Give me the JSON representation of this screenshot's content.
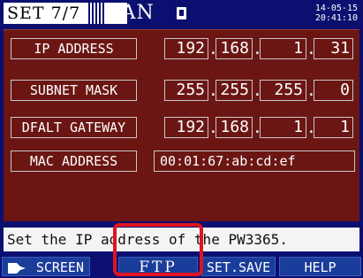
{
  "titlebar": {
    "page": "SET  7/7",
    "section": "LAN",
    "memory_icon": "memory-card-icon",
    "date": "14-05-15",
    "time": "20:41:10"
  },
  "rows": {
    "ip": {
      "label": "IP ADDRESS",
      "octets": [
        "192",
        "168",
        "1",
        "31"
      ]
    },
    "subnet": {
      "label": "SUBNET MASK",
      "octets": [
        "255",
        "255",
        "255",
        "0"
      ]
    },
    "gateway": {
      "label": "DFALT GATEWAY",
      "octets": [
        "192",
        "168",
        "1",
        "1"
      ]
    },
    "mac": {
      "label": "MAC ADDRESS",
      "value": "00:01:67:ab:cd:ef"
    }
  },
  "separator": ".",
  "message": "Set the IP address of the PW3365.",
  "fkeys": {
    "screen": "SCREEN",
    "ftp": "FTP",
    "setsave": "SET.SAVE",
    "help": "HELP"
  },
  "colors": {
    "background": "#0b1070",
    "panel": "#6b1613",
    "highlight": "#e0141e"
  }
}
